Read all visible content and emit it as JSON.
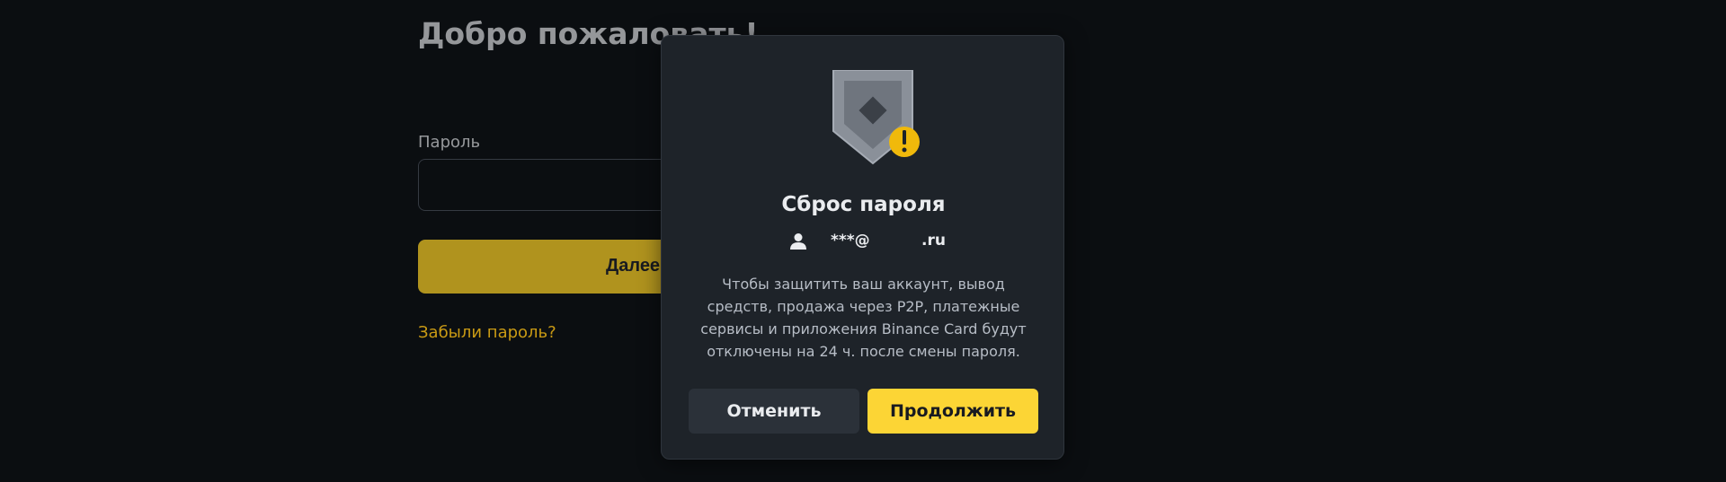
{
  "login": {
    "title": "Добро пожаловать!",
    "password_label": "Пароль",
    "next_button": "Далее",
    "forgot_link": "Забыли пароль?"
  },
  "modal": {
    "title": "Сброс пароля",
    "account_prefix": "***@",
    "account_suffix": ".ru",
    "description": "Чтобы защитить ваш аккаунт, вывод средств, продажа через P2P, платежные сервисы и приложения Binance Card будут отключены на 24 ч. после смены пароля.",
    "cancel_button": "Отменить",
    "continue_button": "Продолжить",
    "icon": "shield-warning-icon",
    "user_icon": "user-icon"
  },
  "colors": {
    "background": "#0b0e11",
    "modal_bg": "#1e2329",
    "accent": "#fcd535",
    "link": "#c99a14"
  }
}
